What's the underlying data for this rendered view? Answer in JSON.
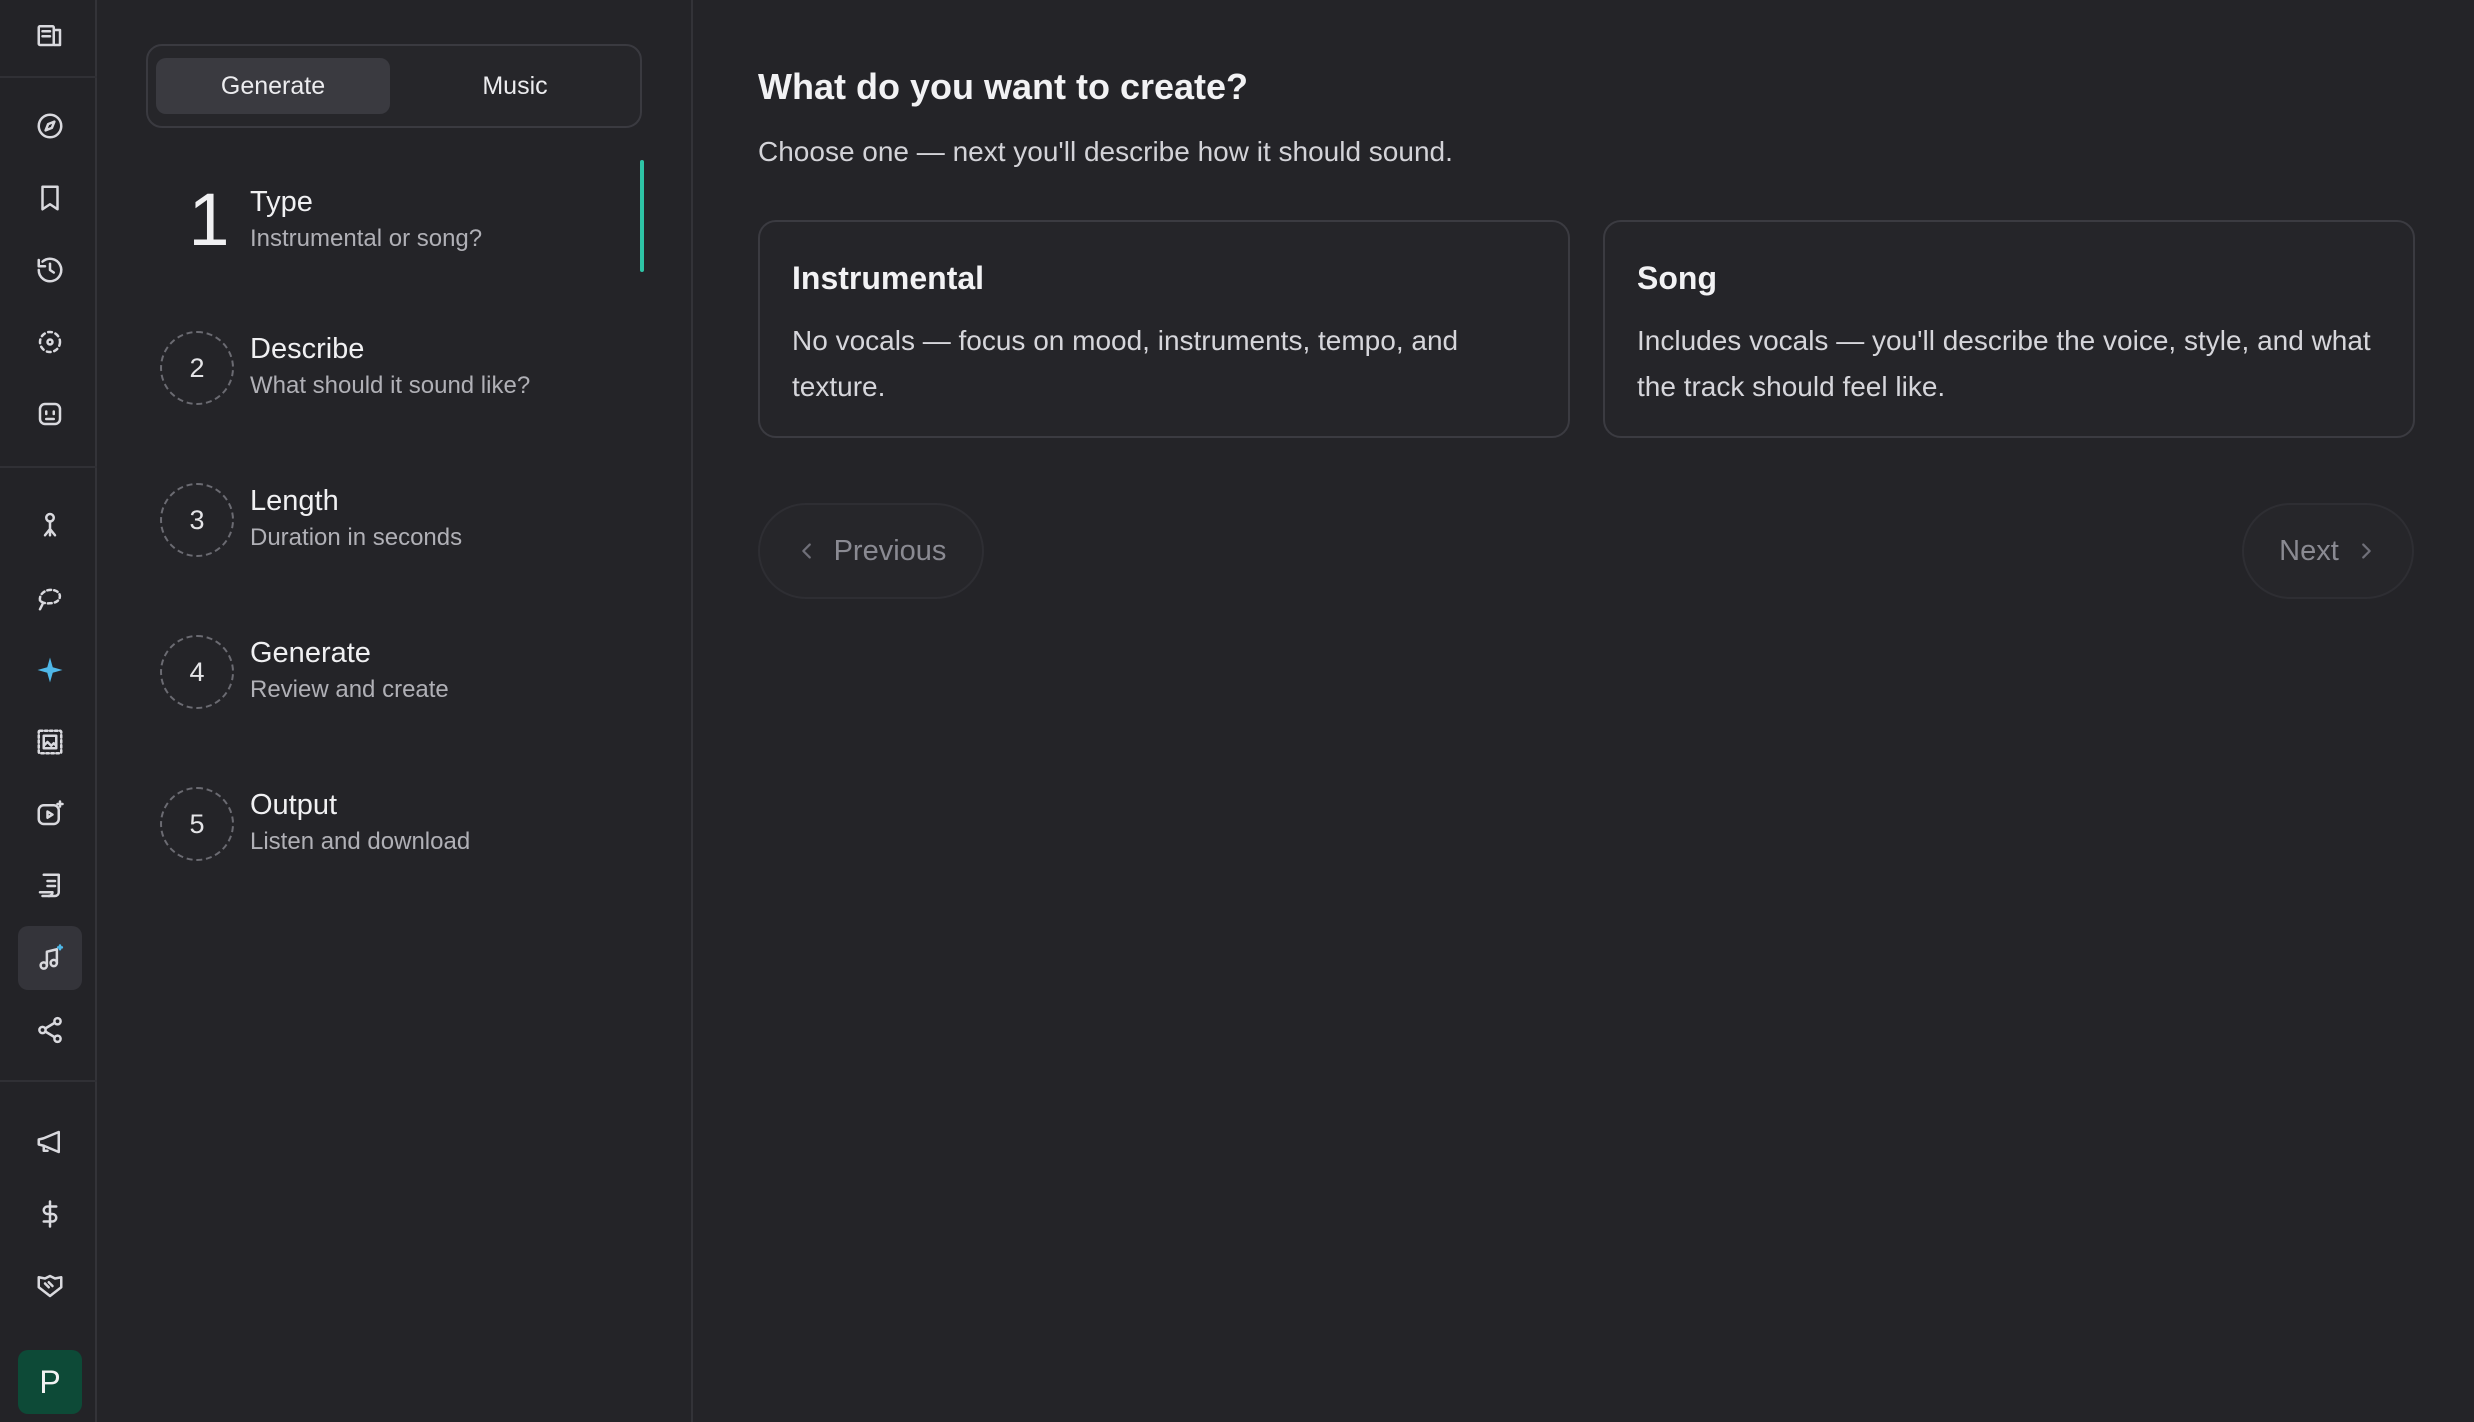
{
  "rail": {
    "icons": [
      "compass-icon",
      "bookmark-icon",
      "history-icon",
      "scan-icon",
      "bot-icon",
      "pin-icon",
      "lasso-icon",
      "sparkle-icon",
      "image-frame-icon",
      "video-sparkle-icon",
      "script-icon",
      "music-icon",
      "share-icon",
      "megaphone-icon",
      "dollar-icon",
      "handshake-icon"
    ],
    "active": "music-icon",
    "accent_color": "#4fb8e8",
    "avatar_letter": "P",
    "avatar_color": "#0d4a37"
  },
  "tabs": {
    "generate": "Generate",
    "music": "Music"
  },
  "steps": [
    {
      "number": "1",
      "title": "Type",
      "subtitle": "Instrumental or song?"
    },
    {
      "number": "2",
      "title": "Describe",
      "subtitle": "What should it sound like?"
    },
    {
      "number": "3",
      "title": "Length",
      "subtitle": "Duration in seconds"
    },
    {
      "number": "4",
      "title": "Generate",
      "subtitle": "Review and create"
    },
    {
      "number": "5",
      "title": "Output",
      "subtitle": "Listen and download"
    }
  ],
  "active_step_color": "#2ec4a6",
  "main": {
    "heading": "What do you want to create?",
    "description": "Choose one — next you'll describe how it should sound.",
    "options": [
      {
        "title": "Instrumental",
        "description": "No vocals — focus on mood, instruments, tempo, and texture."
      },
      {
        "title": "Song",
        "description": "Includes vocals — you'll describe the voice, style, and what the track should feel like."
      }
    ],
    "previous_label": "Previous",
    "next_label": "Next"
  }
}
